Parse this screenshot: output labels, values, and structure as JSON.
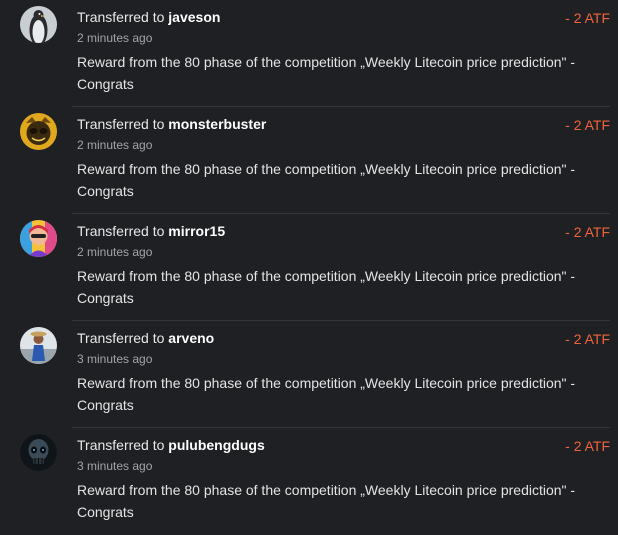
{
  "transfers": [
    {
      "prefix": "Transferred to ",
      "user": "javeson",
      "time": "2 minutes ago",
      "memo": "Reward from the 80 phase of the competition „Weekly Litecoin price prediction\" - Congrats",
      "amount": "- 2 ATF",
      "avatar_icon": "penguin-avatar"
    },
    {
      "prefix": "Transferred to ",
      "user": "monsterbuster",
      "time": "2 minutes ago",
      "memo": "Reward from the 80 phase of the competition „Weekly Litecoin price prediction\" - Congrats",
      "amount": "- 2 ATF",
      "avatar_icon": "monster-avatar"
    },
    {
      "prefix": "Transferred to ",
      "user": "mirror15",
      "time": "2 minutes ago",
      "memo": "Reward from the 80 phase of the competition „Weekly Litecoin price prediction\" - Congrats",
      "amount": "- 2 ATF",
      "avatar_icon": "colorful-portrait-avatar"
    },
    {
      "prefix": "Transferred to ",
      "user": "arveno",
      "time": "3 minutes ago",
      "memo": "Reward from the 80 phase of the competition „Weekly Litecoin price prediction\" - Congrats",
      "amount": "- 2 ATF",
      "avatar_icon": "person-avatar"
    },
    {
      "prefix": "Transferred to ",
      "user": "pulubengdugs",
      "time": "3 minutes ago",
      "memo": "Reward from the 80 phase of the competition „Weekly Litecoin price prediction\" - Congrats",
      "amount": "- 2 ATF",
      "avatar_icon": "skull-avatar"
    }
  ],
  "colors": {
    "background": "#1f2023",
    "amount": "#f0643c",
    "muted": "#a2a4a8"
  }
}
